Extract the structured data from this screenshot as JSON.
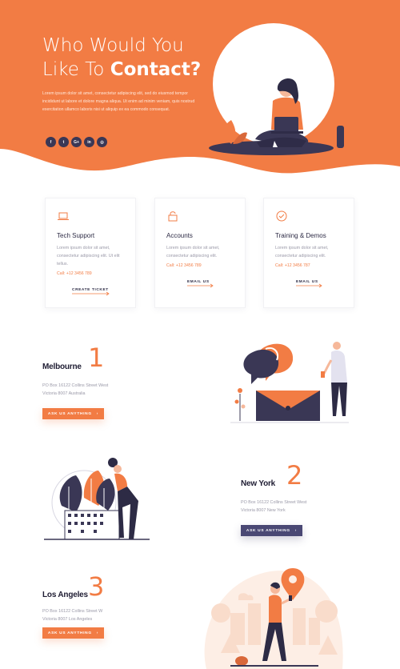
{
  "hero": {
    "title_line1": "Who Would You",
    "title_line2_prefix": "Like To ",
    "title_line2_bold": "Contact?",
    "description": "Lorem ipsum dolor sit amet, consectetur adipiscing elit, sed do eiusmod tempor incididunt ut labore et dolore magna aliqua. Ut enim ad minim veniam, quis nostrud exercitation ullamco laboris nisi ut aliquip ex ea commodo consequat.",
    "socials": [
      {
        "icon": "facebook-icon",
        "glyph": "f"
      },
      {
        "icon": "twitter-icon",
        "glyph": "t"
      },
      {
        "icon": "google-plus-icon",
        "glyph": "G+"
      },
      {
        "icon": "linkedin-icon",
        "glyph": "in"
      },
      {
        "icon": "instagram-icon",
        "glyph": "◎"
      }
    ]
  },
  "cards": [
    {
      "icon": "laptop-icon",
      "title": "Tech Support",
      "text": "Lorem ipsum dolor sit amet, consectetur adipiscing elit. Ut elit tellus.",
      "call": "Call: +12 3456 789",
      "action": "CREATE TICKET"
    },
    {
      "icon": "lock-icon",
      "title": "Accounts",
      "text": "Lorem ipsum dolor sit amet, consectetur adipiscing elit.",
      "call": "Call: +12 3456 789",
      "action": "EMAIL US"
    },
    {
      "icon": "check-circle-icon",
      "title": "Training & Demos",
      "text": "Lorem ipsum dolor sit amet, consectetur adipiscing elit.",
      "call": "Call: +12 3456 787",
      "action": "EMAIL US"
    }
  ],
  "locations": [
    {
      "name": "Melbourne",
      "number": "1",
      "address_line1": "PO Box 16122 Collins Street West",
      "address_line2": "Victoria 8007 Australia",
      "button": "ASK US ANYTHING"
    },
    {
      "name": "New York",
      "number": "2",
      "address_line1": "PO Box 16122 Collins Street West",
      "address_line2": "Victoria 8007 New York",
      "button": "ASK US ANYTHING"
    },
    {
      "name": "Los Angeles",
      "number": "3",
      "address_line1": "PO Box 16122 Collins Street W",
      "address_line2": "Victoria 8007 Los Angeles",
      "button": "ASK US ANYTHING"
    }
  ],
  "colors": {
    "accent": "#f27c44",
    "navy": "#4a4874",
    "dark": "#2d2b45"
  }
}
